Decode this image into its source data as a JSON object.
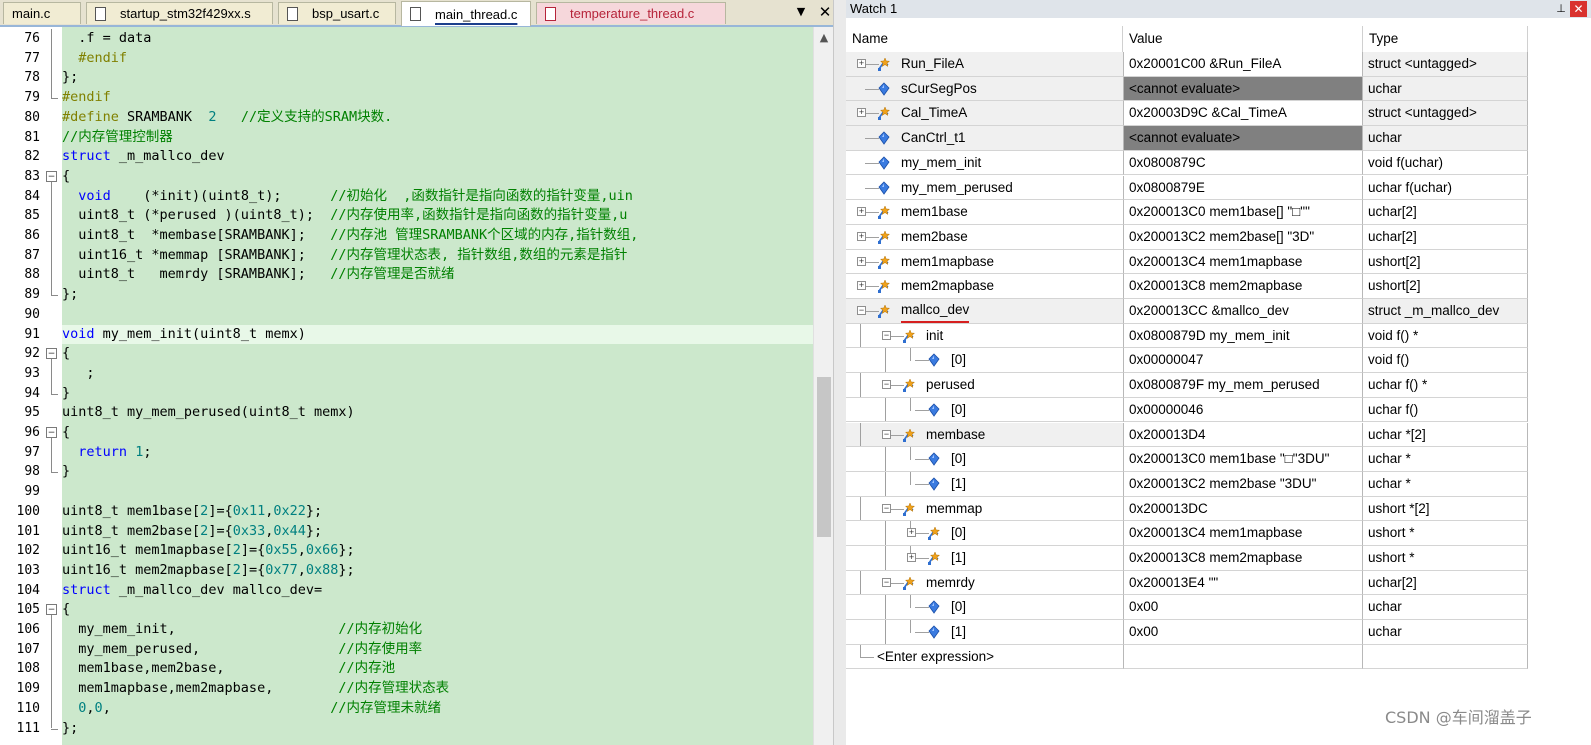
{
  "tabs": [
    {
      "label": "main.c"
    },
    {
      "label": "startup_stm32f429xx.s"
    },
    {
      "label": "bsp_usart.c"
    },
    {
      "label": "main_thread.c"
    },
    {
      "label": "temperature_thread.c"
    }
  ],
  "tab_controls": {
    "menu": "▼",
    "close": "✕"
  },
  "code_lines": [
    {
      "n": "76",
      "text": "  .f = data"
    },
    {
      "n": "77",
      "text": "  #endif"
    },
    {
      "n": "78",
      "text": "};"
    },
    {
      "n": "79",
      "text": "#endif"
    },
    {
      "n": "80",
      "text": "#define SRAMBANK  2   //定义支持的SRAM块数."
    },
    {
      "n": "81",
      "text": "//内存管理控制器"
    },
    {
      "n": "82",
      "text": "struct _m_mallco_dev"
    },
    {
      "n": "83",
      "text": "{"
    },
    {
      "n": "84",
      "text": "  void    (*init)(uint8_t);      //初始化  ,函数指针是指向函数的指针变量,uin"
    },
    {
      "n": "85",
      "text": "  uint8_t (*perused )(uint8_t);  //内存使用率,函数指针是指向函数的指针变量,u"
    },
    {
      "n": "86",
      "text": "  uint8_t  *membase[SRAMBANK];   //内存池 管理SRAMBANK个区域的内存,指针数组,"
    },
    {
      "n": "87",
      "text": "  uint16_t *memmap [SRAMBANK];   //内存管理状态表, 指针数组,数组的元素是指针"
    },
    {
      "n": "88",
      "text": "  uint8_t   memrdy [SRAMBANK];   //内存管理是否就绪"
    },
    {
      "n": "89",
      "text": "};"
    },
    {
      "n": "90",
      "text": ""
    },
    {
      "n": "91",
      "text": "void my_mem_init(uint8_t memx)"
    },
    {
      "n": "92",
      "text": "{"
    },
    {
      "n": "93",
      "text": "   ;"
    },
    {
      "n": "94",
      "text": "}"
    },
    {
      "n": "95",
      "text": "uint8_t my_mem_perused(uint8_t memx)"
    },
    {
      "n": "96",
      "text": "{"
    },
    {
      "n": "97",
      "text": "  return 1;"
    },
    {
      "n": "98",
      "text": "}"
    },
    {
      "n": "99",
      "text": ""
    },
    {
      "n": "100",
      "text": "uint8_t mem1base[2]={0x11,0x22};"
    },
    {
      "n": "101",
      "text": "uint8_t mem2base[2]={0x33,0x44};"
    },
    {
      "n": "102",
      "text": "uint16_t mem1mapbase[2]={0x55,0x66};"
    },
    {
      "n": "103",
      "text": "uint16_t mem2mapbase[2]={0x77,0x88};"
    },
    {
      "n": "104",
      "text": "struct _m_mallco_dev mallco_dev="
    },
    {
      "n": "105",
      "text": "{"
    },
    {
      "n": "106",
      "text": "  my_mem_init,                    //内存初始化"
    },
    {
      "n": "107",
      "text": "  my_mem_perused,                 //内存使用率"
    },
    {
      "n": "108",
      "text": "  mem1base,mem2base,              //内存池"
    },
    {
      "n": "109",
      "text": "  mem1mapbase,mem2mapbase,        //内存管理状态表"
    },
    {
      "n": "110",
      "text": "  0,0,                           //内存管理未就绪"
    },
    {
      "n": "111",
      "text": "};"
    }
  ],
  "watch": {
    "title": "Watch 1",
    "pin": "⊥",
    "close": "✕",
    "columns": {
      "name": "Name",
      "value": "Value",
      "type": "Type"
    },
    "rows": [
      {
        "name": "Run_FileA",
        "value": "0x20001C00 &Run_FileA",
        "type": "struct <untagged>",
        "depth": 0,
        "expander": "+",
        "icon": "struct-icon"
      },
      {
        "name": "sCurSegPos",
        "value": "<cannot evaluate>",
        "type": "uchar",
        "depth": 0,
        "expander": "",
        "icon": "variable-icon",
        "dark": true
      },
      {
        "name": "Cal_TimeA",
        "value": "0x20003D9C &Cal_TimeA",
        "type": "struct <untagged>",
        "depth": 0,
        "expander": "+",
        "icon": "struct-icon"
      },
      {
        "name": "CanCtrl_t1",
        "value": "<cannot evaluate>",
        "type": "uchar",
        "depth": 0,
        "expander": "",
        "icon": "variable-icon",
        "dark": true
      },
      {
        "name": "my_mem_init",
        "value": "0x0800879C",
        "type": "void f(uchar)",
        "depth": 0,
        "expander": "",
        "icon": "variable-icon"
      },
      {
        "name": "my_mem_perused",
        "value": "0x0800879E",
        "type": "uchar f(uchar)",
        "depth": 0,
        "expander": "",
        "icon": "variable-icon"
      },
      {
        "name": "mem1base",
        "value": "0x200013C0 mem1base[] \"□\"\"",
        "type": "uchar[2]",
        "depth": 0,
        "expander": "+",
        "icon": "struct-icon"
      },
      {
        "name": "mem2base",
        "value": "0x200013C2 mem2base[] \"3D\"",
        "type": "uchar[2]",
        "depth": 0,
        "expander": "+",
        "icon": "struct-icon"
      },
      {
        "name": "mem1mapbase",
        "value": "0x200013C4 mem1mapbase",
        "type": "ushort[2]",
        "depth": 0,
        "expander": "+",
        "icon": "struct-icon"
      },
      {
        "name": "mem2mapbase",
        "value": "0x200013C8 mem2mapbase",
        "type": "ushort[2]",
        "depth": 0,
        "expander": "+",
        "icon": "struct-icon"
      },
      {
        "name": "mallco_dev",
        "value": "0x200013CC &mallco_dev",
        "type": "struct _m_mallco_dev",
        "depth": 0,
        "expander": "−",
        "icon": "struct-icon",
        "underline": true
      },
      {
        "name": "init",
        "value": "0x0800879D my_mem_init",
        "type": "void f()  *",
        "depth": 1,
        "expander": "−",
        "icon": "struct-icon"
      },
      {
        "name": "[0]",
        "value": "0x00000047",
        "type": "void f()",
        "depth": 2,
        "expander": "",
        "icon": "variable-icon"
      },
      {
        "name": "perused",
        "value": "0x0800879F my_mem_perused",
        "type": "uchar f()  *",
        "depth": 1,
        "expander": "−",
        "icon": "struct-icon"
      },
      {
        "name": "[0]",
        "value": "0x00000046",
        "type": "uchar f()",
        "depth": 2,
        "expander": "",
        "icon": "variable-icon"
      },
      {
        "name": "membase",
        "value": "0x200013D4",
        "type": "uchar *[2]",
        "depth": 1,
        "expander": "−",
        "icon": "struct-icon",
        "selname": true
      },
      {
        "name": "[0]",
        "value": "0x200013C0 mem1base \"□\"3DU\"",
        "type": "uchar *",
        "depth": 2,
        "expander": "",
        "icon": "variable-icon"
      },
      {
        "name": "[1]",
        "value": "0x200013C2 mem2base \"3DU\"",
        "type": "uchar *",
        "depth": 2,
        "expander": "",
        "icon": "variable-icon"
      },
      {
        "name": "memmap",
        "value": "0x200013DC",
        "type": "ushort *[2]",
        "depth": 1,
        "expander": "−",
        "icon": "struct-icon"
      },
      {
        "name": "[0]",
        "value": "0x200013C4 mem1mapbase",
        "type": "ushort *",
        "depth": 2,
        "expander": "+",
        "icon": "struct-icon"
      },
      {
        "name": "[1]",
        "value": "0x200013C8 mem2mapbase",
        "type": "ushort *",
        "depth": 2,
        "expander": "+",
        "icon": "struct-icon"
      },
      {
        "name": "memrdy",
        "value": "0x200013E4 \"\"",
        "type": "uchar[2]",
        "depth": 1,
        "expander": "−",
        "icon": "struct-icon"
      },
      {
        "name": "[0]",
        "value": "0x00",
        "type": "uchar",
        "depth": 2,
        "expander": "",
        "icon": "variable-icon"
      },
      {
        "name": "[1]",
        "value": "0x00",
        "type": "uchar",
        "depth": 2,
        "expander": "",
        "icon": "variable-icon"
      },
      {
        "name": "<Enter expression>",
        "value": "",
        "type": "",
        "depth": -1,
        "expander": "",
        "icon": ""
      }
    ]
  },
  "watermark": "CSDN @车间溜盖子"
}
